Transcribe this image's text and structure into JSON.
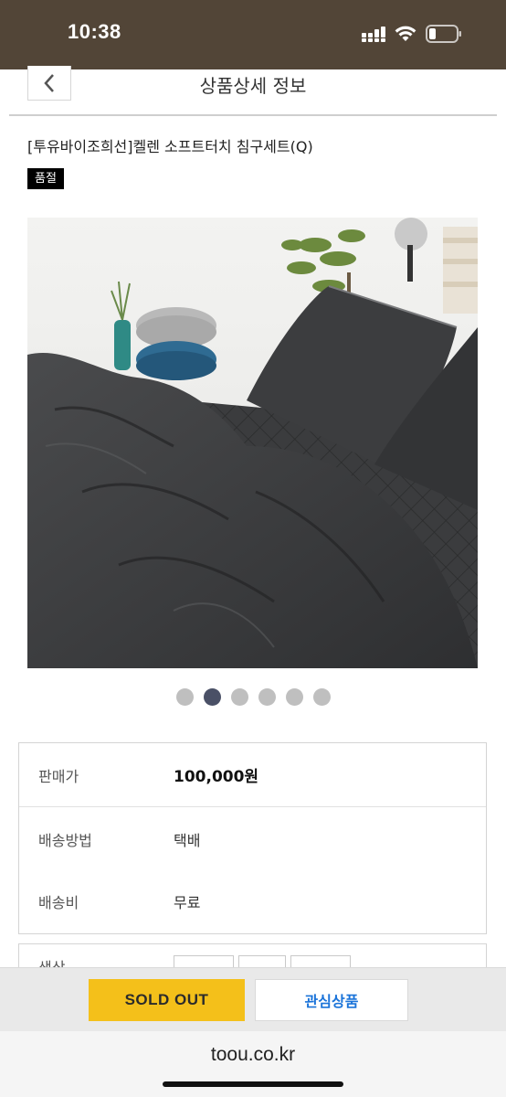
{
  "status_bar": {
    "time": "10:38",
    "icons": [
      "signal-icon",
      "wifi-icon",
      "battery-icon"
    ]
  },
  "header": {
    "title": "상품상세 정보",
    "back_icon": "chevron-left-icon"
  },
  "product": {
    "title": "[투유바이조희선]켈렌 소프트터치 침구세트(Q)",
    "badge": "품절",
    "image_description": "dark gray bedding set photo"
  },
  "carousel": {
    "total": 6,
    "active_index": 1
  },
  "info": {
    "price_label": "판매가",
    "price_value": "100,000원",
    "shipping_method_label": "배송방법",
    "shipping_method_value": "택배",
    "shipping_fee_label": "배송비",
    "shipping_fee_value": "무료"
  },
  "options": {
    "label": "색상"
  },
  "actions": {
    "soldout_label": "SOLD OUT",
    "wishlist_label": "관심상품"
  },
  "browser": {
    "url": "toou.co.kr"
  },
  "colors": {
    "status_bar_bg": "#524537",
    "soldout_button": "#f4c01a",
    "wishlist_text": "#1a73d9",
    "active_dot": "#4a5066",
    "inactive_dot": "#bfbfbf"
  }
}
